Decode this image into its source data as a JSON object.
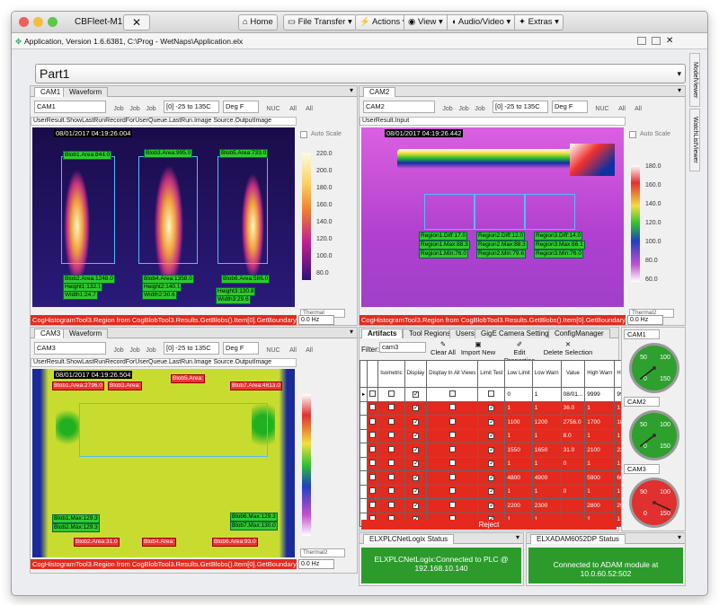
{
  "titlebar": {
    "app_name": "CBFleet-M1",
    "close_tab": "✕",
    "home": "Home",
    "file_transfer": "File Transfer",
    "actions": "Actions",
    "view": "View",
    "audio_video": "Audio/Video",
    "extras": "Extras"
  },
  "appbar": {
    "title": "Application, Version 1.6.6381, C:\\Prog - WetNaps\\Application.elx"
  },
  "part": {
    "value": "Part1"
  },
  "side_tabs": [
    "ModelViewer",
    "WatchListViewer"
  ],
  "cam1": {
    "tabs": [
      "CAM1",
      "Waveform"
    ],
    "camera": "CAM1",
    "range": "[0] -25 to 135C",
    "unit": "Deg F",
    "tools": [
      "Job",
      "Job",
      "Job",
      "NUC",
      "All",
      "All"
    ],
    "path": "UserResult.ShowLastRunRecordForUserQueue.LastRun.Image Source.OutputImage",
    "timestamp": "08/01/2017 04:19:26.004",
    "auto_scale": "Auto Scale",
    "legend_ticks": [
      "220.0",
      "200.0",
      "180.0",
      "160.0",
      "140.0",
      "120.0",
      "100.0",
      "80.0"
    ],
    "palette": "Thermal",
    "error": "CogHistogramTool3.Region from CogBlobTool3.Results.GetBlobs().Item[0].GetBoundary(). Unable to ac",
    "hz": "0.0 Hz",
    "labels": [
      "Blob1.Area:844.0",
      "Blob3.Area:995.0",
      "Blob5.Area:733.0",
      "Blob2.Area:1248.0",
      "Height1:132.1",
      "Width1:24.7",
      "Blob4.Area:1358.0",
      "Height2:140.1",
      "Width2:30.6",
      "Blob6.Area:586.0",
      "Height3:130.8",
      "Width3:29.6"
    ]
  },
  "cam2": {
    "tabs": [
      "CAM2"
    ],
    "camera": "CAM2",
    "range": "[0] -25 to 135C",
    "unit": "Deg F",
    "tools": [
      "Job",
      "Job",
      "Job",
      "NUC",
      "All",
      "All"
    ],
    "path": "UserResult.Input",
    "timestamp": "08/01/2017 04:19:26.442",
    "auto_scale": "Auto Scale",
    "legend_ticks": [
      "180.0",
      "160.0",
      "140.0",
      "120.0",
      "100.0",
      "80.0",
      "60.0"
    ],
    "palette": "Thermal2",
    "error": "CogHistogramTool3.Region from CogBlobTool3.Results.GetBlobs().Item[0].GetBoundary(). Unable to ac",
    "hz": "0.0 Hz",
    "labels": [
      "Region1.Diff:17.0",
      "Region2.Diff:12.0",
      "Region3.Diff:14.0",
      "Region1.Max:88.3",
      "Region2.Max:88.3",
      "Region3.Max:86.1",
      "Region1.Min:76.0",
      "Region2.Min:79.6",
      "Region3.Min:76.0"
    ]
  },
  "cam3": {
    "tabs": [
      "CAM3",
      "Waveform"
    ],
    "camera": "CAM3",
    "range": "[0] -25 to 135C",
    "unit": "Deg F",
    "tools": [
      "Job",
      "Job",
      "Job",
      "NUC",
      "All",
      "All"
    ],
    "path": "UserResult.ShowLastRunRecordForUserQueue.LastRun.Image Source.OutputImage",
    "timestamp": "08/01/2017 04:19:26.504",
    "palette": "Thermal2",
    "error": "CogHistogramTool3.Region from CogBlobTool3.Results.GetBlobs().Item[0].GetBoundary(). Unable to ac",
    "hz": "0.0 Hz",
    "labels": [
      "Blob1.Area:2796.0",
      "Blob3.Area:",
      "Blob5.Area:",
      "Blob7.Area:4613.0",
      "Blob1.Max:129.3",
      "Blob2.Max:129.3",
      "Blob6.Max:129.3",
      "Blob7.Max:130.0",
      "Blob2.Area:31.0",
      "Blob4.Area:",
      "Blob6.Area:93.0"
    ]
  },
  "artifacts": {
    "tabs": [
      "Artifacts",
      "Tool Regions",
      "Users",
      "GigE Camera Settings",
      "ConfigManager"
    ],
    "filter_label": "Filter:",
    "filter_value": "cam3",
    "buttons": [
      "Clear All",
      "Import New",
      "Edit Properties",
      "Delete Selection"
    ],
    "columns": [
      "Isometric",
      "Display",
      "Display In All Views",
      "Limit Test",
      "Low Limit",
      "Low Warn",
      "Value",
      "High Warn",
      "High Limit"
    ],
    "rows": [
      {
        "display": true,
        "limit": false,
        "low_limit": "0",
        "low_warn": "1",
        "value": "08/01...",
        "high_warn": "9999",
        "high_limit": "9999",
        "red": false
      },
      {
        "display": true,
        "limit": true,
        "low_limit": "1",
        "low_warn": "1",
        "value": "36.0",
        "high_warn": "1",
        "high_limit": "1",
        "red": true
      },
      {
        "display": true,
        "limit": true,
        "low_limit": "1100",
        "low_warn": "1200",
        "value": "2756.0",
        "high_warn": "1700",
        "high_limit": "1880",
        "red": true
      },
      {
        "display": true,
        "limit": true,
        "low_limit": "1",
        "low_warn": "1",
        "value": "8.0",
        "high_warn": "1",
        "high_limit": "1",
        "red": true
      },
      {
        "display": true,
        "limit": true,
        "low_limit": "1550",
        "low_warn": "1650",
        "value": "31.0",
        "high_warn": "2100",
        "high_limit": "2200",
        "red": true
      },
      {
        "display": true,
        "limit": true,
        "low_limit": "1",
        "low_warn": "1",
        "value": "0",
        "high_warn": "1",
        "high_limit": "1",
        "red": true
      },
      {
        "display": true,
        "limit": true,
        "low_limit": "4800",
        "low_warn": "4900",
        "value": "",
        "high_warn": "5900",
        "high_limit": "6000",
        "red": true
      },
      {
        "display": true,
        "limit": true,
        "low_limit": "1",
        "low_warn": "1",
        "value": "0",
        "high_warn": "1",
        "high_limit": "1",
        "red": true
      },
      {
        "display": true,
        "limit": true,
        "low_limit": "2200",
        "low_warn": "2300",
        "value": "",
        "high_warn": "2800",
        "high_limit": "2900",
        "red": true
      },
      {
        "display": true,
        "limit": true,
        "low_limit": "1",
        "low_warn": "1",
        "value": "",
        "high_warn": "1",
        "high_limit": "1",
        "red": true
      }
    ],
    "reject": "Reject"
  },
  "gauges": [
    {
      "label": "CAM1",
      "color": "#2ea02e",
      "needle": 0.3
    },
    {
      "label": "CAM2",
      "color": "#2ea02e",
      "needle": 0.3
    },
    {
      "label": "CAM3",
      "color": "#e03030",
      "needle": 0.75
    }
  ],
  "gauge_ticks": [
    "50",
    "100",
    "0",
    "150"
  ],
  "status_panels": [
    {
      "title": "ELXPLCNetLogix Status",
      "text": "ELXPLCNetLogix:Connected to PLC @ 192.168.10.140"
    },
    {
      "title": "ELXADAM6052DP Status",
      "text": "Connected to ADAM module at 10.0.60.52:502"
    }
  ],
  "colors": {
    "error": "#e42a1e",
    "ok": "#2c9b2c",
    "reject": "#e42a1e"
  }
}
